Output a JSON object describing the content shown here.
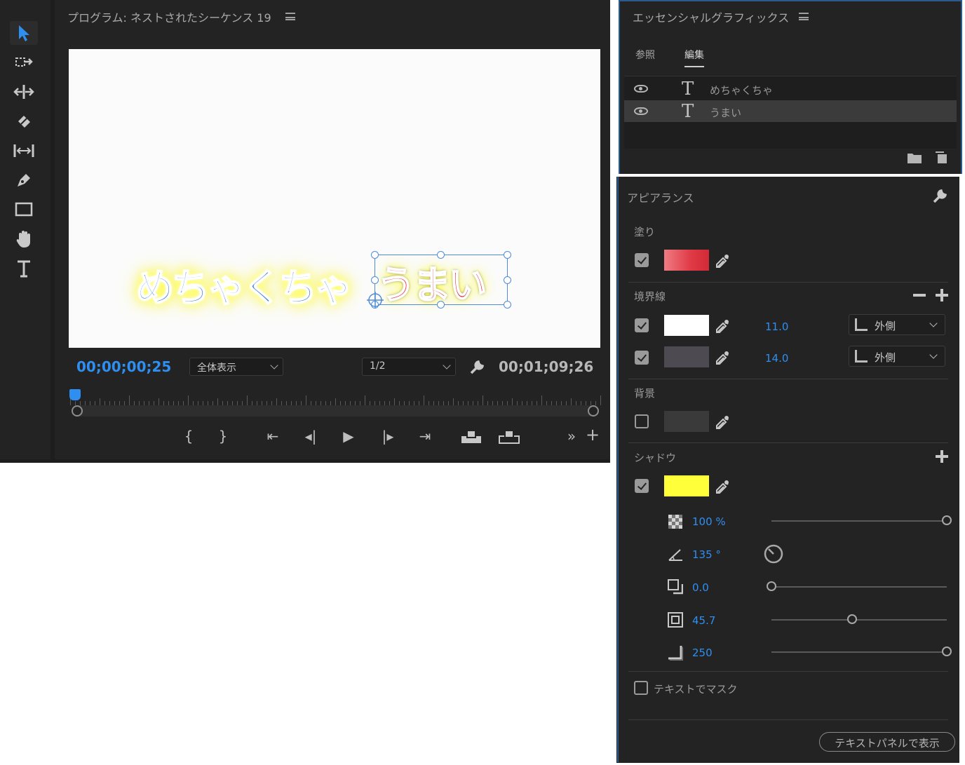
{
  "program_monitor": {
    "title": "プログラム: ネストされたシーケンス 19",
    "timecode_current": "00;00;00;25",
    "timecode_duration": "00;01;09;26",
    "fit_select": "全体表示",
    "resolution_select": "1/2",
    "canvas_text_left": "めちゃくちゃ",
    "canvas_text_right": "うまい",
    "controls": [
      "{",
      "}",
      "⇤",
      "◂|",
      "▶",
      "|▸",
      "⇥",
      "",
      "",
      "»",
      "+"
    ]
  },
  "essential_graphics": {
    "title": "エッセンシャルグラフィックス",
    "tabs": {
      "browse": "参照",
      "edit": "編集"
    },
    "layers": [
      {
        "name": "めちゃくちゃ",
        "selected": false
      },
      {
        "name": "うまい",
        "selected": true
      }
    ]
  },
  "appearance": {
    "title": "アピアランス",
    "fill": {
      "label": "塗り",
      "enabled": true,
      "color": "#e2454f"
    },
    "stroke": {
      "label": "境界線",
      "items": [
        {
          "enabled": true,
          "color": "#ffffff",
          "width": "11.0",
          "position": "外側"
        },
        {
          "enabled": true,
          "color": "#4d4a52",
          "width": "14.0",
          "position": "外側"
        }
      ]
    },
    "background": {
      "label": "背景",
      "enabled": false,
      "color": "#3a3a3a"
    },
    "shadow": {
      "label": "シャドウ",
      "enabled": true,
      "color": "#ffff3a",
      "opacity": "100 %",
      "angle": "135 °",
      "distance": "0.0",
      "size": "45.7",
      "blur": "250",
      "opacity_level": 1.0,
      "distance_level": 0.0,
      "size_level": 0.46,
      "blur_level": 1.0
    },
    "mask_label": "テキストでマスク",
    "show_in_text_panel": "テキストパネルで表示"
  },
  "colors": {
    "accent_blue": "#2f8ff0",
    "panel_bg": "#232323"
  }
}
